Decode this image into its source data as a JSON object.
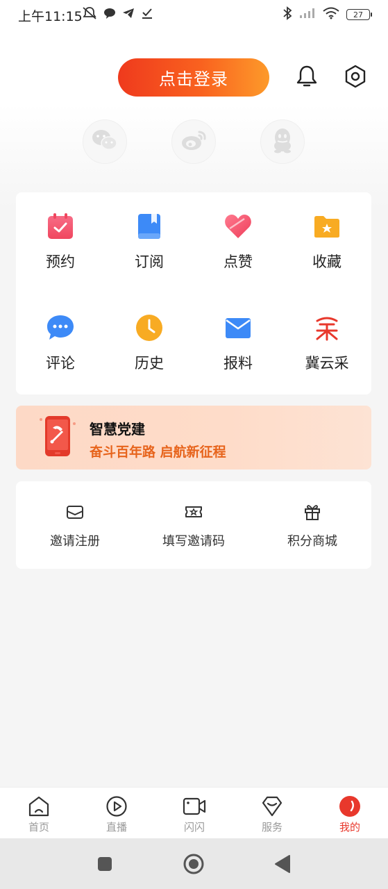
{
  "status_bar": {
    "time": "上午11:15",
    "battery": "27"
  },
  "header": {
    "login_label": "点击登录",
    "icons": [
      "bell-icon",
      "settings-icon"
    ]
  },
  "social_login": [
    "wechat-icon",
    "weibo-icon",
    "qq-icon"
  ],
  "grid": {
    "items": [
      {
        "label": "预约",
        "icon": "calendar-icon",
        "color": "#f4506a"
      },
      {
        "label": "订阅",
        "icon": "bookmark-book-icon",
        "color": "#3d8af7"
      },
      {
        "label": "点赞",
        "icon": "heart-icon",
        "color": "#f4506a"
      },
      {
        "label": "收藏",
        "icon": "star-folder-icon",
        "color": "#f8ab23"
      },
      {
        "label": "评论",
        "icon": "comment-icon",
        "color": "#3d8af7"
      },
      {
        "label": "历史",
        "icon": "clock-icon",
        "color": "#f8ab23"
      },
      {
        "label": "报料",
        "icon": "mail-icon",
        "color": "#3d8af7"
      },
      {
        "label": "冀云采",
        "icon": "jiyuncai-logo-icon",
        "color": "#e8382c"
      }
    ]
  },
  "party_banner": {
    "title": "智慧党建",
    "subtitle": "奋斗百年路 启航新征程"
  },
  "invite": {
    "items": [
      {
        "label": "邀请注册",
        "icon": "envelope-icon"
      },
      {
        "label": "填写邀请码",
        "icon": "ticket-icon"
      },
      {
        "label": "积分商城",
        "icon": "gift-icon"
      }
    ]
  },
  "bottom_nav": {
    "items": [
      {
        "label": "首页",
        "icon": "home-icon"
      },
      {
        "label": "直播",
        "icon": "live-play-icon"
      },
      {
        "label": "闪闪",
        "icon": "video-camera-icon"
      },
      {
        "label": "服务",
        "icon": "diamond-service-icon"
      },
      {
        "label": "我的",
        "icon": "profile-icon",
        "active": true
      }
    ],
    "active_color": "#e8382c"
  },
  "colors": {
    "accent": "#f9621f",
    "accent_start": "#ef3a1d",
    "accent_end": "#fd9a2a"
  }
}
